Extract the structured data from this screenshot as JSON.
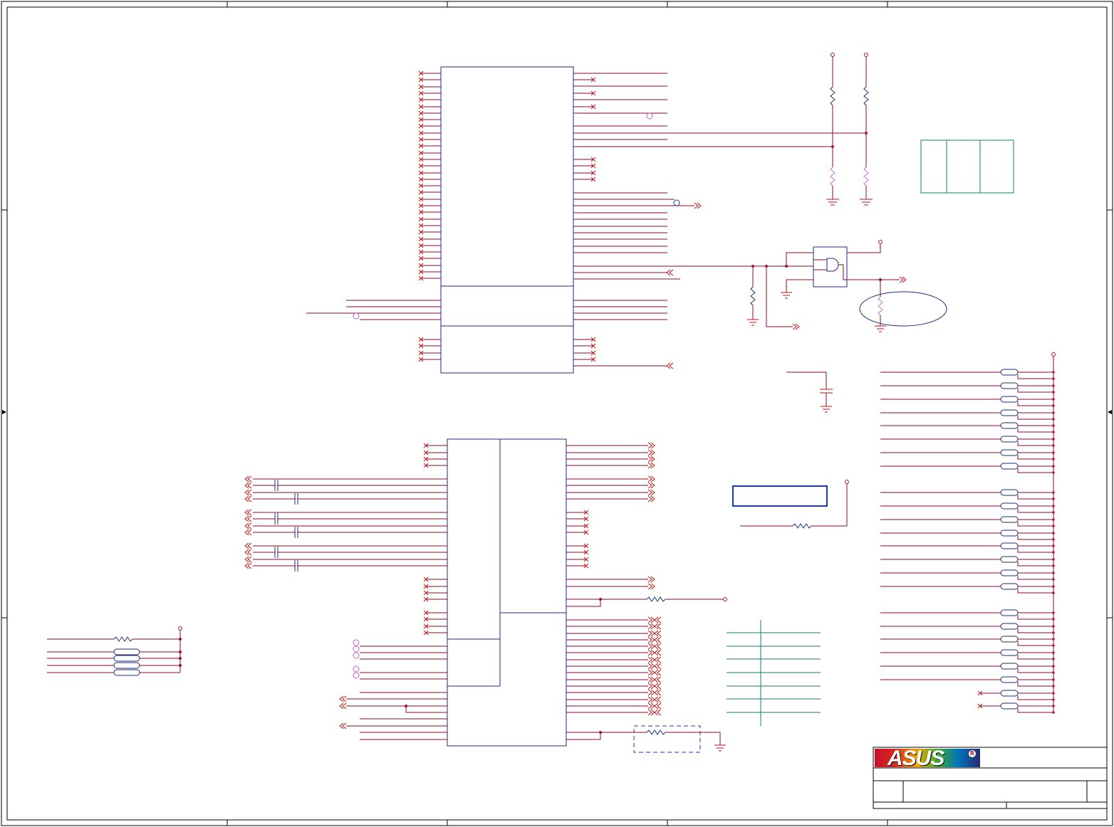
{
  "diagram": {
    "kind": "schematic-sheet",
    "colors": {
      "border": "#000000",
      "box": "#1e2a7a",
      "wire": "#8b0a2a",
      "pin": "#c01010",
      "junction": "#b01050",
      "ground": "#c01010",
      "pink": "#d060c0",
      "teal": "#1a7a70",
      "blue": "#1a3aaa",
      "resistor_alt": "#d070d0"
    },
    "logo": {
      "brand": "ASUS",
      "registered_mark": "R"
    }
  }
}
